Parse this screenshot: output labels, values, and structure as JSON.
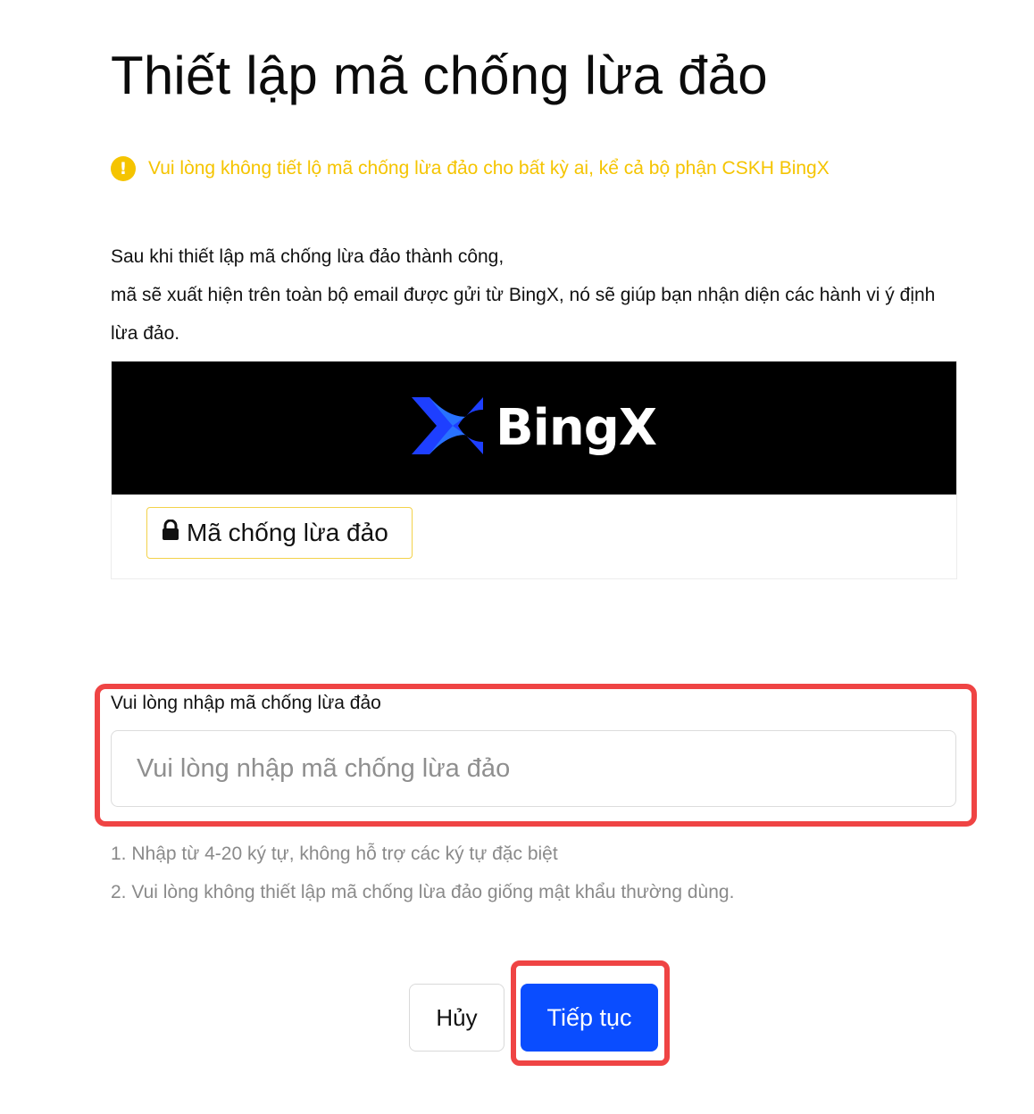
{
  "page": {
    "title": "Thiết lập mã chống lừa đảo"
  },
  "warning": {
    "icon": "info-icon",
    "text": "Vui lòng không tiết lộ mã chống lừa đảo cho bất kỳ ai, kể cả bộ phận CSKH BingX",
    "color": "#f5c400"
  },
  "description": {
    "line1": "Sau khi thiết lập mã chống lừa đảo thành công,",
    "line2": "mã sẽ xuất hiện trên toàn bộ email được gửi từ BingX, nó sẽ giúp bạn nhận diện các hành vi ý định lừa đảo."
  },
  "email_preview": {
    "brand_name": "BingX",
    "brand_colors": [
      "#1e3fff",
      "#2a7bff"
    ],
    "code_chip_icon": "lock-icon",
    "code_chip_label": "Mã chống lừa đảo"
  },
  "form": {
    "label": "Vui lòng nhập mã chống lừa đảo",
    "input_value": "",
    "input_placeholder": "Vui lòng nhập mã chống lừa đảo",
    "rules": [
      "1. Nhập từ 4-20 ký tự, không hỗ trợ các ký tự đặc biệt",
      "2. Vui lòng không thiết lập mã chống lừa đảo giống mật khẩu thường dùng."
    ]
  },
  "actions": {
    "cancel_label": "Hủy",
    "continue_label": "Tiếp tục",
    "primary_color": "#0a4dff",
    "highlight_color": "#ef4444"
  }
}
